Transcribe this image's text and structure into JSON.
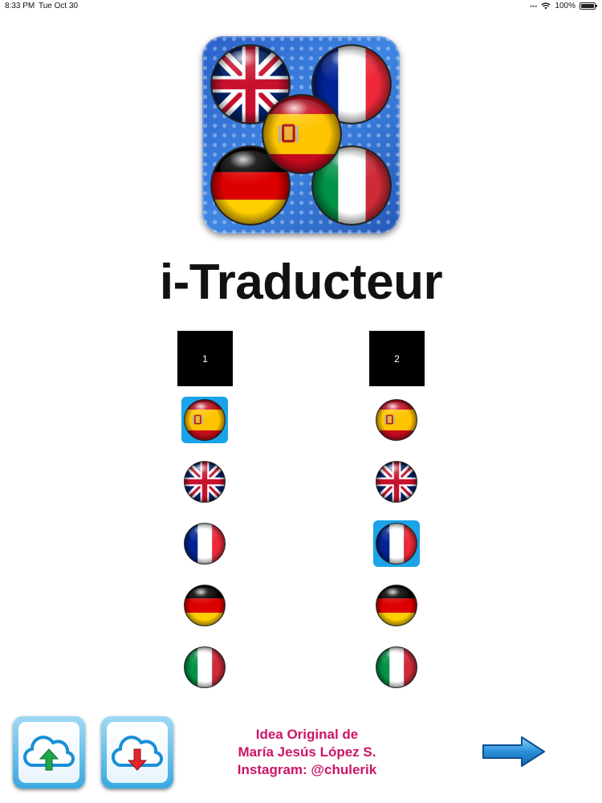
{
  "status_bar": {
    "time": "8:33 PM",
    "date": "Tue Oct 30",
    "battery": "100%",
    "battery_level": 1.0
  },
  "app": {
    "title": "i-Traducteur"
  },
  "columns": [
    {
      "number": "1",
      "selected": "spanish",
      "flags": [
        {
          "id": "spanish",
          "icon": "spain-flag-icon"
        },
        {
          "id": "english",
          "icon": "uk-flag-icon"
        },
        {
          "id": "french",
          "icon": "france-flag-icon"
        },
        {
          "id": "german",
          "icon": "germany-flag-icon"
        },
        {
          "id": "italian",
          "icon": "italy-flag-icon"
        }
      ]
    },
    {
      "number": "2",
      "selected": "french",
      "flags": [
        {
          "id": "spanish",
          "icon": "spain-flag-icon"
        },
        {
          "id": "english",
          "icon": "uk-flag-icon"
        },
        {
          "id": "french",
          "icon": "france-flag-icon"
        },
        {
          "id": "german",
          "icon": "germany-flag-icon"
        },
        {
          "id": "italian",
          "icon": "italy-flag-icon"
        }
      ]
    }
  ],
  "footer": {
    "upload_icon": "cloud-upload-icon",
    "download_icon": "cloud-download-icon",
    "credits": [
      "Idea Original de",
      "María Jesús López S.",
      "Instagram: @chulerik"
    ],
    "next_icon": "arrow-right-icon"
  },
  "colors": {
    "selected_highlight": "#1aa3e8",
    "credits_text": "#cc1467",
    "arrow": "#2a8fd8"
  }
}
